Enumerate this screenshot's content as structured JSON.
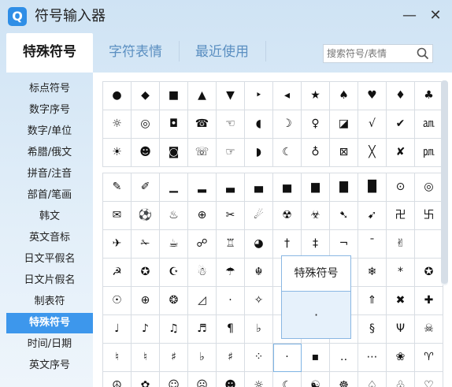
{
  "window": {
    "title": "符号输入器",
    "logo_letter": "Q",
    "minimize_glyph": "—",
    "close_glyph": "✕"
  },
  "tabs": [
    {
      "label": "特殊符号",
      "active": true
    },
    {
      "label": "字符表情",
      "active": false
    },
    {
      "label": "最近使用",
      "active": false
    }
  ],
  "search": {
    "placeholder": "搜索符号/表情"
  },
  "sidebar": {
    "items": [
      {
        "label": "标点符号"
      },
      {
        "label": "数字序号"
      },
      {
        "label": "数字/单位"
      },
      {
        "label": "希腊/俄文"
      },
      {
        "label": "拼音/注音"
      },
      {
        "label": "部首/笔画"
      },
      {
        "label": "韩文"
      },
      {
        "label": "英文音标"
      },
      {
        "label": "日文平假名"
      },
      {
        "label": "日文片假名"
      },
      {
        "label": "制表符"
      },
      {
        "label": "特殊符号",
        "active": true
      },
      {
        "label": "时间/日期"
      },
      {
        "label": "英文序号"
      }
    ]
  },
  "grid_top": [
    [
      "●",
      "◆",
      "■",
      "▲",
      "▼",
      "‣",
      "◂",
      "★",
      "♠",
      "♥",
      "♦",
      "♣"
    ],
    [
      "☼",
      "◎",
      "◘",
      "☎",
      "☜",
      "◖",
      "☽",
      "♀",
      "◪",
      "√",
      "✔",
      "㏂"
    ],
    [
      "☀",
      "☻",
      "◙",
      "☏",
      "☞",
      "◗",
      "☾",
      "♁",
      "⊠",
      "╳",
      "✘",
      "㏘"
    ]
  ],
  "grid_bottom": [
    [
      "✎",
      "✐",
      "▁",
      "▂",
      "▃",
      "▄",
      "▅",
      "▆",
      "▇",
      "█",
      "⊙",
      "◎"
    ],
    [
      "✉",
      "⚽",
      "♨",
      "⊕",
      "✂",
      "☄",
      "☢",
      "☣",
      "➷",
      "➹",
      "卍",
      "卐"
    ],
    [
      "✈",
      "✁",
      "☕",
      "☍",
      "♖",
      "◕",
      "†",
      "‡",
      "¬",
      "¯",
      "✌",
      ""
    ],
    [
      "☭",
      "✪",
      "☪",
      "☃",
      "☂",
      "☬",
      "",
      "",
      "",
      "❄",
      "*",
      "✪"
    ],
    [
      "☉",
      "⊕",
      "❂",
      "◿",
      "·",
      "✧",
      "",
      "",
      "",
      "⇑",
      "✖",
      "✚"
    ],
    [
      "♩",
      "♪",
      "♫",
      "♬",
      "¶",
      "♭",
      "",
      "",
      "",
      "§",
      "Ψ",
      "☠"
    ],
    [
      "♮",
      "♮",
      "♯",
      "♭",
      "♯",
      "⁘",
      "·",
      "▪",
      "‥",
      "⋯",
      "❀",
      "♈"
    ],
    [
      "☮",
      "✿",
      "☺",
      "☹",
      "☻",
      "☼",
      "☾",
      "☯",
      "☸",
      "♤",
      "♧",
      "♡"
    ]
  ],
  "popup": {
    "title": "特殊符号",
    "preview": "·"
  }
}
